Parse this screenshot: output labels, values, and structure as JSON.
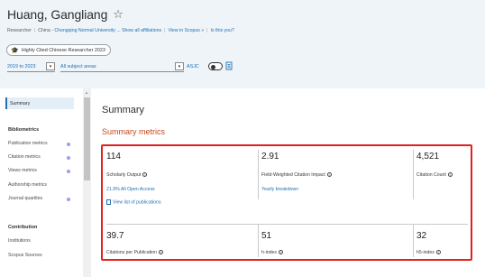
{
  "profile": {
    "name": "Huang, Gangliang",
    "star_icon": "star-outline-icon",
    "role": "Researcher",
    "country": "China",
    "affiliation": "Chongqing Normal University ...",
    "show_all": "Show all affiliations",
    "view_scopus": "View in Scopus »",
    "is_this_you": "Is this you?",
    "badge_label": "Highly Cited Chinese Researcher 2023",
    "badge_icon": "graduation-cap-icon"
  },
  "filters": {
    "year_range": "2019 to 2023",
    "subject": "All subject areas",
    "classification": "ASJC",
    "toggle_state": "off"
  },
  "sidebar": {
    "selected": "Summary",
    "groups": [
      {
        "heading": "Bibliometrics",
        "items": [
          {
            "label": "Publication metrics",
            "dot": true
          },
          {
            "label": "Citation metrics",
            "dot": true
          },
          {
            "label": "Views metrics",
            "dot": true
          },
          {
            "label": "Authorship metrics",
            "dot": false
          },
          {
            "label": "Journal quartiles",
            "dot": true
          }
        ]
      },
      {
        "heading": "Contribution",
        "items": [
          {
            "label": "Institutions",
            "dot": false
          },
          {
            "label": "Scopus Sources",
            "dot": false
          }
        ]
      }
    ]
  },
  "main": {
    "title": "Summary",
    "section_title": "Summary metrics",
    "metrics": [
      {
        "value": "114",
        "label": "Scholarly Output",
        "sub1": "21.9% All Open Access",
        "sub2": "View list of publications"
      },
      {
        "value": "2.91",
        "label": "Field-Weighted Citation Impact",
        "sub1": "Yearly breakdown"
      },
      {
        "value": "4,521",
        "label": "Citation Count"
      },
      {
        "value": "39.7",
        "label": "Citations per Publication"
      },
      {
        "value": "51",
        "label": "h-index"
      },
      {
        "value": "32",
        "label": "h5-index"
      }
    ]
  },
  "colors": {
    "accent": "#1f6fb5",
    "section_title": "#c24a1c",
    "highlight_border": "#e2201e",
    "header_bg": "#eef4f8"
  }
}
